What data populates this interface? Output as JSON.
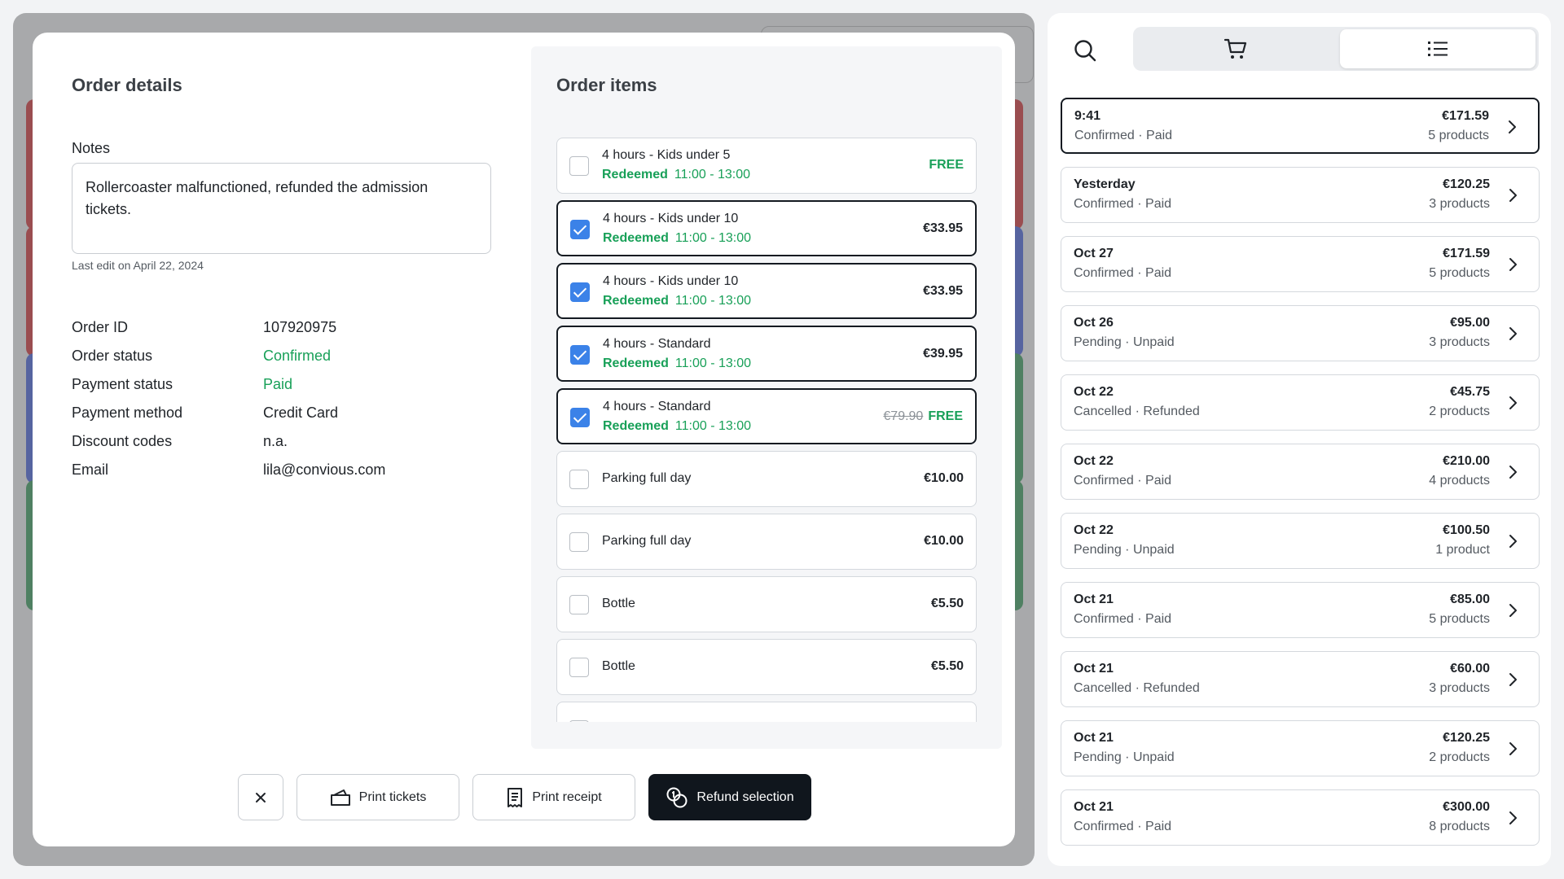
{
  "order_details": {
    "title": "Order details",
    "notes_label": "Notes",
    "notes_value": "Rollercoaster malfunctioned, refunded the admission tickets.",
    "last_edit": "Last edit on April 22, 2024",
    "fields": [
      {
        "label": "Order ID",
        "value": "107920975",
        "color": "default"
      },
      {
        "label": "Order status",
        "value": "Confirmed",
        "color": "green"
      },
      {
        "label": "Payment status",
        "value": "Paid",
        "color": "green"
      },
      {
        "label": "Payment method",
        "value": "Credit Card",
        "color": "default"
      },
      {
        "label": "Discount codes",
        "value": "n.a.",
        "color": "default"
      },
      {
        "label": "Email",
        "value": "lila@convious.com",
        "color": "default"
      }
    ]
  },
  "order_items": {
    "title": "Order items",
    "items": [
      {
        "name": "4 hours - Kids under 5",
        "status": "Redeemed",
        "time": "11:00 - 13:00",
        "price": "FREE",
        "old_price": "",
        "free": true,
        "checked": false
      },
      {
        "name": "4 hours - Kids under 10",
        "status": "Redeemed",
        "time": "11:00 - 13:00",
        "price": "€33.95",
        "old_price": "",
        "free": false,
        "checked": true
      },
      {
        "name": "4 hours - Kids under 10",
        "status": "Redeemed",
        "time": "11:00 - 13:00",
        "price": "€33.95",
        "old_price": "",
        "free": false,
        "checked": true
      },
      {
        "name": "4 hours - Standard",
        "status": "Redeemed",
        "time": "11:00 - 13:00",
        "price": "€39.95",
        "old_price": "",
        "free": false,
        "checked": true
      },
      {
        "name": "4 hours - Standard",
        "status": "Redeemed",
        "time": "11:00 - 13:00",
        "price": "FREE",
        "old_price": "€79.90",
        "free": true,
        "checked": true
      },
      {
        "name": "Parking full day",
        "status": "",
        "time": "",
        "price": "€10.00",
        "old_price": "",
        "free": false,
        "checked": false
      },
      {
        "name": "Parking full day",
        "status": "",
        "time": "",
        "price": "€10.00",
        "old_price": "",
        "free": false,
        "checked": false
      },
      {
        "name": "Bottle",
        "status": "",
        "time": "",
        "price": "€5.50",
        "old_price": "",
        "free": false,
        "checked": false
      },
      {
        "name": "Bottle",
        "status": "",
        "time": "",
        "price": "€5.50",
        "old_price": "",
        "free": false,
        "checked": false
      },
      {
        "name": "",
        "status": "",
        "time": "",
        "price": "",
        "old_price": "",
        "free": false,
        "checked": false
      }
    ]
  },
  "actions": {
    "close_icon": "close-icon",
    "print_tickets": "Print tickets",
    "print_receipt": "Print receipt",
    "refund_selection": "Refund selection"
  },
  "sidebar": {
    "search_icon": "search-icon",
    "tabs": [
      {
        "icon": "cart-icon"
      },
      {
        "icon": "list-icon",
        "active": true
      }
    ],
    "orders": [
      {
        "date": "9:41",
        "status": "Confirmed · Paid",
        "amount": "€171.59",
        "products": "5 products",
        "selected": true
      },
      {
        "date": "Yesterday",
        "status": "Confirmed · Paid",
        "amount": "€120.25",
        "products": "3 products"
      },
      {
        "date": "Oct 27",
        "status": "Confirmed · Paid",
        "amount": "€171.59",
        "products": "5 products"
      },
      {
        "date": "Oct 26",
        "status": "Pending · Unpaid",
        "amount": "€95.00",
        "products": "3 products"
      },
      {
        "date": "Oct 22",
        "status": "Cancelled · Refunded",
        "amount": "€45.75",
        "products": "2 products"
      },
      {
        "date": "Oct 22",
        "status": "Confirmed · Paid",
        "amount": "€210.00",
        "products": "4 products"
      },
      {
        "date": "Oct 22",
        "status": "Pending · Unpaid",
        "amount": "€100.50",
        "products": "1 product"
      },
      {
        "date": "Oct 21",
        "status": "Confirmed · Paid",
        "amount": "€85.00",
        "products": "5 products"
      },
      {
        "date": "Oct 21",
        "status": "Cancelled · Refunded",
        "amount": "€60.00",
        "products": "3 products"
      },
      {
        "date": "Oct 21",
        "status": "Pending · Unpaid",
        "amount": "€120.25",
        "products": "2 products"
      },
      {
        "date": "Oct 21",
        "status": "Confirmed · Paid",
        "amount": "€300.00",
        "products": "8 products"
      }
    ]
  },
  "colors": {
    "green": "#18a058",
    "accent_blue": "#3b82e8",
    "dark_button": "#10161d",
    "bg_red": "#c2565c",
    "bg_blue": "#5f79c4",
    "bg_green": "#4e9a6b"
  }
}
